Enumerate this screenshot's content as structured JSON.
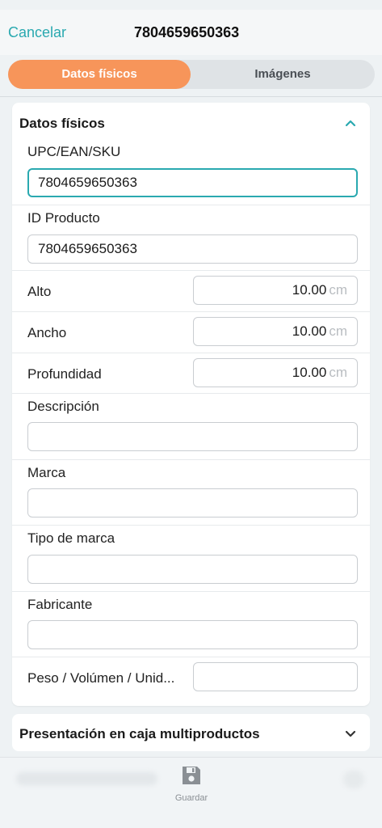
{
  "header": {
    "cancel_label": "Cancelar",
    "title": "7804659650363"
  },
  "tabs": [
    {
      "label": "Datos físicos",
      "active": true
    },
    {
      "label": "Imágenes",
      "active": false
    }
  ],
  "section": {
    "title": "Datos físicos",
    "fields": {
      "upc": {
        "label": "UPC/EAN/SKU",
        "value": "7804659650363"
      },
      "product_id": {
        "label": "ID Producto",
        "value": "7804659650363"
      },
      "alto": {
        "label": "Alto",
        "value": "10.00",
        "unit": "cm"
      },
      "ancho": {
        "label": "Ancho",
        "value": "10.00",
        "unit": "cm"
      },
      "profundidad": {
        "label": "Profundidad",
        "value": "10.00",
        "unit": "cm"
      },
      "descripcion": {
        "label": "Descripción",
        "value": ""
      },
      "marca": {
        "label": "Marca",
        "value": ""
      },
      "tipo_marca": {
        "label": "Tipo de marca",
        "value": ""
      },
      "fabricante": {
        "label": "Fabricante",
        "value": ""
      },
      "peso": {
        "label": "Peso / Volúmen / Unid...",
        "value": ""
      }
    }
  },
  "section2": {
    "title": "Presentación en caja multiproductos"
  },
  "footer": {
    "save_label": "Guardar"
  },
  "colors": {
    "accent": "#2aa9b0",
    "active_tab": "#f7955a"
  },
  "icons": [
    "chevron-up-icon",
    "chevron-down-icon",
    "save-icon"
  ]
}
